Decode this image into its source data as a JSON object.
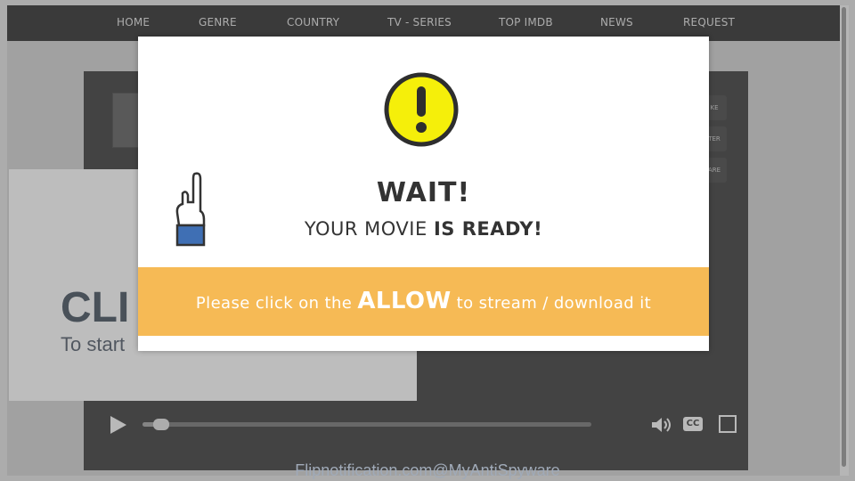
{
  "nav": {
    "items": [
      "HOME",
      "GENRE",
      "COUNTRY",
      "TV - SERIES",
      "TOP IMDB",
      "NEWS",
      "REQUEST"
    ]
  },
  "player": {
    "side_buttons": [
      "KE",
      "TER",
      "ARE"
    ],
    "promo_big": "CLI",
    "promo_small": "To start",
    "progress": 0.04,
    "cc_label": "CC"
  },
  "modal": {
    "title": "WAIT!",
    "subtitle_pre": "YOUR MOVIE ",
    "subtitle_bold": "IS READY!",
    "cta_pre": "Please click on the ",
    "cta_bold": "ALLOW",
    "cta_post": " to stream / download it",
    "accent_color": "#f6ba55",
    "warn_color": "#f5ef0a"
  },
  "watermark": "Flipnotification.com@MyAntiSpyware",
  "icons": [
    "exclamation-icon",
    "hand-pointing-up-icon",
    "play-icon",
    "volume-icon",
    "cc-icon",
    "fullscreen-icon"
  ]
}
